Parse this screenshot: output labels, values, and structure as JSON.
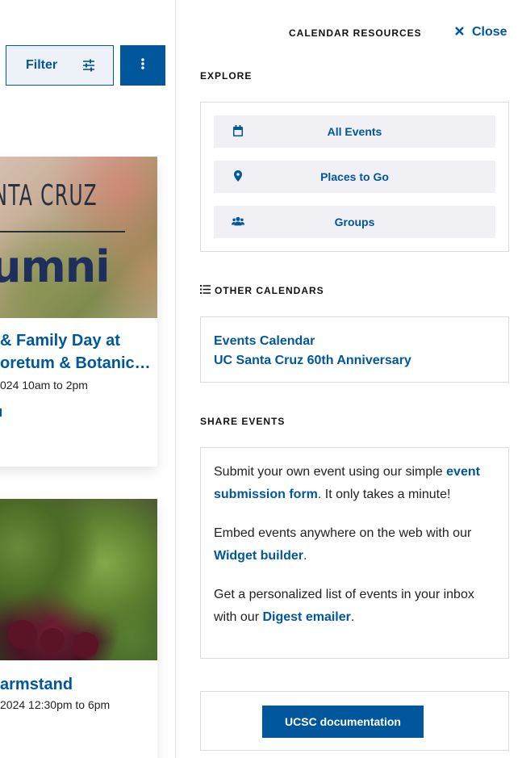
{
  "left": {
    "filter_label": "Filter",
    "events": [
      {
        "title_line1": "& Family Day at",
        "title_line2": "oretum & Botanic…",
        "date": "024 10am to 2pm",
        "image_line1": "ANTA CRUZ",
        "image_line2": "umni"
      },
      {
        "title_line1": "armstand",
        "date": " 2024 12:30pm to 6pm"
      }
    ]
  },
  "panel": {
    "header": "CALENDAR RESOURCES",
    "close_label": "Close",
    "explore": {
      "title": "EXPLORE",
      "items": [
        {
          "label": "All Events",
          "icon": "calendar-icon"
        },
        {
          "label": "Places to Go",
          "icon": "map-marker-icon"
        },
        {
          "label": "Groups",
          "icon": "users-icon"
        }
      ]
    },
    "other_calendars": {
      "title": "OTHER CALENDARS",
      "items": [
        "Events Calendar",
        "UC Santa Cruz 60th Anniversary"
      ]
    },
    "share": {
      "title": "SHARE EVENTS",
      "p1_before": "Submit your own event using our simple ",
      "p1_link": "event submission form",
      "p1_after": ". It only takes a minute!",
      "p2_before": "Embed events anywhere on the web with our ",
      "p2_link": "Widget builder",
      "p2_after": ".",
      "p3_before": "Get a personalized list of events in your inbox with our ",
      "p3_link": "Digest emailer",
      "p3_after": "."
    },
    "docs_label": "UCSC documentation"
  },
  "colors": {
    "brand": "#00579b",
    "panel_item_bg": "#f0f0f5"
  }
}
